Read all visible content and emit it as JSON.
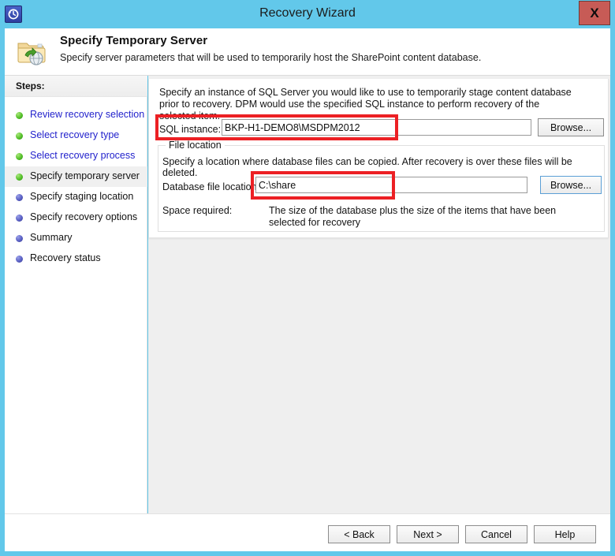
{
  "window": {
    "title": "Recovery Wizard",
    "app_icon": "recovery-restore-icon",
    "close_label": "X",
    "frame_color": "#62c8ea"
  },
  "header": {
    "icon": "folder-restore-icon",
    "title": "Specify Temporary Server",
    "subtitle": "Specify server parameters that will be used to temporarily host the SharePoint content database."
  },
  "sidebar": {
    "heading": "Steps:",
    "items": [
      {
        "label": "Review recovery selection",
        "state": "done"
      },
      {
        "label": "Select recovery type",
        "state": "done"
      },
      {
        "label": "Select recovery process",
        "state": "done"
      },
      {
        "label": "Specify temporary server",
        "state": "current"
      },
      {
        "label": "Specify staging location",
        "state": "pending"
      },
      {
        "label": "Specify recovery options",
        "state": "pending"
      },
      {
        "label": "Summary",
        "state": "pending"
      },
      {
        "label": "Recovery status",
        "state": "pending"
      }
    ]
  },
  "main": {
    "intro": "Specify an instance of SQL Server you would like to use to temporarily stage content database prior to recovery. DPM would use the specified SQL instance to perform recovery of the selected item.",
    "sql_instance": {
      "label": "SQL instance:",
      "value": "BKP-H1-DEMO8\\MSDPM2012",
      "placeholder": "",
      "browse_label": "Browse..."
    },
    "file_location": {
      "legend": "File location",
      "description": "Specify a location where database files can be copied. After recovery is over these files will be deleted.",
      "db_file_location": {
        "label": "Database file location:",
        "value": "C:\\share",
        "placeholder": "",
        "browse_label": "Browse..."
      },
      "space_required": {
        "label": "Space required:",
        "value": "The size of the database plus the size of the items that have been selected for recovery"
      }
    }
  },
  "annotations": {
    "color": "#ec2024",
    "boxes": [
      "sql-instance-field",
      "database-file-location-field"
    ]
  },
  "footer": {
    "back_label": "< Back",
    "next_label": "Next >",
    "cancel_label": "Cancel",
    "help_label": "Help"
  }
}
